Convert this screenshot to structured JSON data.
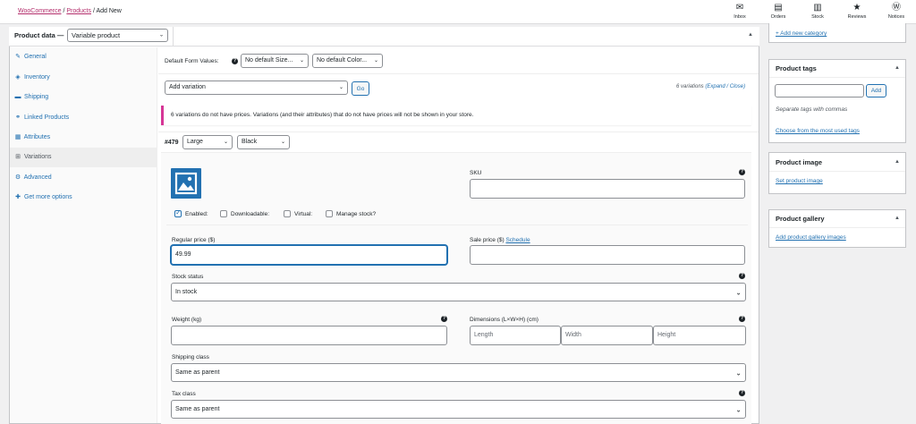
{
  "breadcrumb": {
    "woocommerce": "WooCommerce",
    "sep1": "/",
    "products": "Products",
    "sep2": "/",
    "current": "Add New"
  },
  "topnav": [
    {
      "label": "Inbox",
      "icon": "inbox-icon",
      "glyph": "✉"
    },
    {
      "label": "Orders",
      "icon": "orders-icon",
      "glyph": "▤"
    },
    {
      "label": "Stock",
      "icon": "stock-icon",
      "glyph": "▥"
    },
    {
      "label": "Reviews",
      "icon": "star-icon",
      "glyph": "★"
    },
    {
      "label": "Notices",
      "icon": "wordpress-icon",
      "glyph": "Ⓦ"
    }
  ],
  "product_data": {
    "label": "Product data —",
    "type_value": "Variable product"
  },
  "tabs": [
    {
      "label": "General",
      "glyph": "✎"
    },
    {
      "label": "Inventory",
      "glyph": "◈"
    },
    {
      "label": "Shipping",
      "glyph": "▬"
    },
    {
      "label": "Linked Products",
      "glyph": "⚭"
    },
    {
      "label": "Attributes",
      "glyph": "▦"
    },
    {
      "label": "Variations",
      "glyph": "⊞"
    },
    {
      "label": "Advanced",
      "glyph": "⚙"
    },
    {
      "label": "Get more options",
      "glyph": "✚"
    }
  ],
  "default_form": {
    "label": "Default Form Values:",
    "size_value": "No default Size...",
    "color_value": "No default Color..."
  },
  "add_variation": {
    "select_value": "Add variation",
    "go_label": "Go",
    "count_text": "6 variations",
    "expand_label": "(Expand",
    "close_sep": "/",
    "close_label": "Close)"
  },
  "notice": "6 variations do not have prices. Variations (and their attributes) that do not have prices will not be shown in your store.",
  "variation": {
    "id": "#479",
    "size_value": "Large",
    "color_value": "Black",
    "sku_label": "SKU",
    "sku_value": "",
    "enabled_label": "Enabled:",
    "downloadable_label": "Downloadable:",
    "virtual_label": "Virtual:",
    "manage_stock_label": "Manage stock?",
    "regular_price_label": "Regular price ($)",
    "regular_price_value": "49.99",
    "sale_price_label": "Sale price ($)",
    "schedule_label": "Schedule",
    "sale_price_value": "",
    "stock_status_label": "Stock status",
    "stock_status_value": "In stock",
    "weight_label": "Weight (kg)",
    "weight_value": "",
    "dimensions_label": "Dimensions (L×W×H) (cm)",
    "length_placeholder": "Length",
    "width_placeholder": "Width",
    "height_placeholder": "Height",
    "shipping_class_label": "Shipping class",
    "shipping_class_value": "Same as parent",
    "tax_class_label": "Tax class",
    "tax_class_value": "Same as parent"
  },
  "sidebar": {
    "add_category": "+ Add new category",
    "tags": {
      "title": "Product tags",
      "input_value": "",
      "add_label": "Add",
      "hint": "Separate tags with commas",
      "choose_link": "Choose from the most used tags"
    },
    "image": {
      "title": "Product image",
      "link": "Set product image"
    },
    "gallery": {
      "title": "Product gallery",
      "link": "Add product gallery images"
    }
  },
  "colors": {
    "link": "#2271b1",
    "brand": "#b32d6b",
    "notice_border": "#d63696"
  }
}
